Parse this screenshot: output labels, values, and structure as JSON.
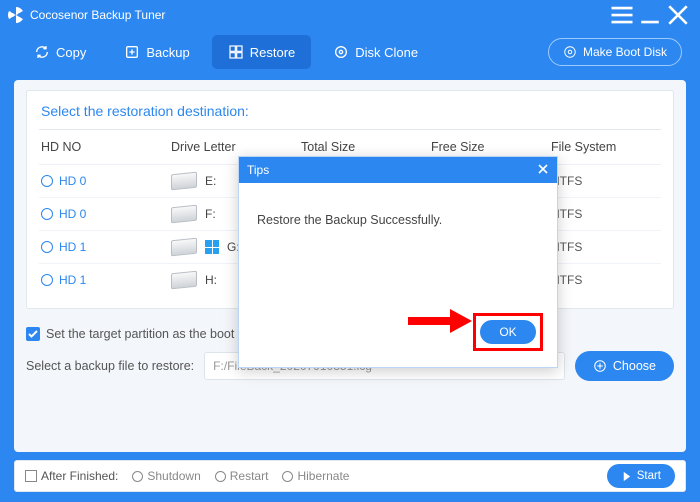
{
  "title": "Cocosenor Backup Tuner",
  "toolbar": {
    "copy": "Copy",
    "backup": "Backup",
    "restore": "Restore",
    "diskclone": "Disk Clone",
    "makeboot": "Make Boot Disk"
  },
  "dest": {
    "heading": "Select the restoration destination:",
    "columns": {
      "hdno": "HD NO",
      "drive": "Drive Letter",
      "total": "Total Size",
      "free": "Free Size",
      "fs": "File System"
    },
    "rows": [
      {
        "hdno": "HD 0",
        "letter": "E:",
        "win": false,
        "fs": "NTFS"
      },
      {
        "hdno": "HD 0",
        "letter": "F:",
        "win": false,
        "fs": "NTFS"
      },
      {
        "hdno": "HD 1",
        "letter": "G:",
        "win": true,
        "fs": "NTFS"
      },
      {
        "hdno": "HD 1",
        "letter": "H:",
        "win": false,
        "fs": "NTFS"
      }
    ]
  },
  "setboot": "Set the target partition as the boot disk?",
  "selectfile_label": "Select a backup file to restore:",
  "selectfile_value": "F:/FileBack_20207910351.icg",
  "choose": "Choose",
  "after": {
    "label": "After Finished:",
    "shutdown": "Shutdown",
    "restart": "Restart",
    "hibernate": "Hibernate"
  },
  "start": "Start",
  "modal": {
    "title": "Tips",
    "message": "Restore the Backup Successfully.",
    "ok": "OK"
  }
}
